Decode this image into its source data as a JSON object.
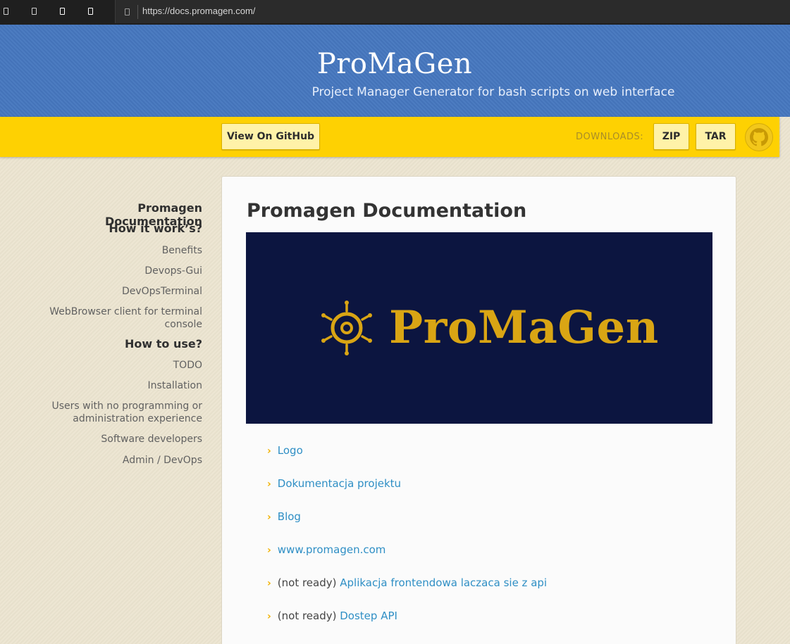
{
  "browser": {
    "url": "https://docs.promagen.com/"
  },
  "header": {
    "title": "ProMaGen",
    "subtitle": "Project Manager Generator for bash scripts on web interface"
  },
  "ribbon": {
    "github_label": "View On GitHub",
    "downloads_label": "DOWNLOADS:",
    "zip_label": "ZIP",
    "tar_label": "TAR"
  },
  "sidebar": {
    "items": [
      {
        "label": "Promagen Documentation",
        "level": "h1"
      },
      {
        "label": "How it work’s?",
        "level": "h2"
      },
      {
        "label": "Benefits",
        "level": "item"
      },
      {
        "label": "Devops-Gui",
        "level": "item"
      },
      {
        "label": "DevOpsTerminal",
        "level": "item"
      },
      {
        "label": "WebBrowser client for terminal console",
        "level": "item"
      },
      {
        "label": "How to use?",
        "level": "h2"
      },
      {
        "label": "TODO",
        "level": "item"
      },
      {
        "label": "Installation",
        "level": "item"
      },
      {
        "label": "Users with no programming or administration experience",
        "level": "item"
      },
      {
        "label": "Software developers",
        "level": "item"
      },
      {
        "label": "Admin / DevOps",
        "level": "item"
      }
    ]
  },
  "main": {
    "title": "Promagen Documentation",
    "banner_text": "ProMaGen",
    "links": [
      {
        "prefix": "",
        "label": "Logo"
      },
      {
        "prefix": "",
        "label": "Dokumentacja projektu"
      },
      {
        "prefix": "",
        "label": "Blog"
      },
      {
        "prefix": "",
        "label": "www.promagen.com"
      },
      {
        "prefix": "(not ready) ",
        "label": "Aplikacja frontendowa laczaca sie z api"
      },
      {
        "prefix": "(not ready) ",
        "label": "Dostep API"
      }
    ]
  },
  "colors": {
    "header_blue": "#4677bf",
    "ribbon_yellow": "#fed102",
    "banner_navy": "#0c1540",
    "logo_gold": "#d9a514",
    "link_blue": "#2f8fc5"
  }
}
